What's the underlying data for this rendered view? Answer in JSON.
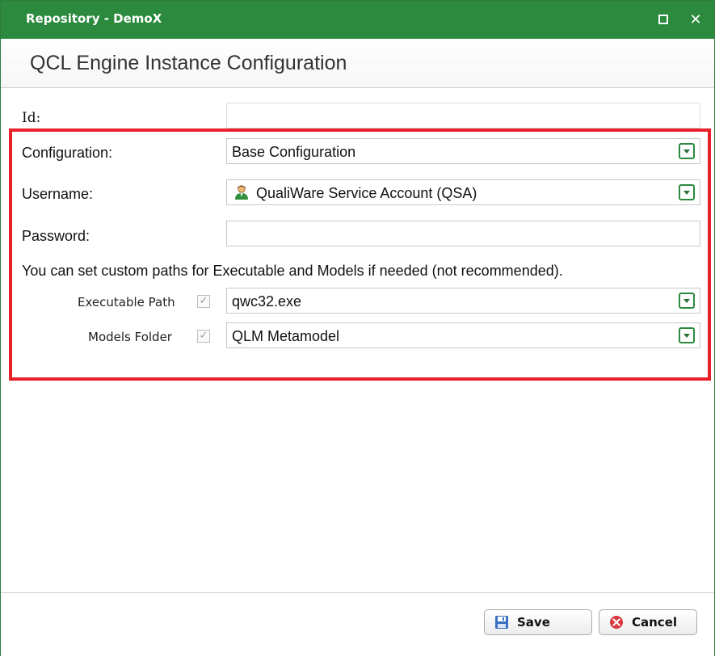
{
  "window": {
    "title": "Repository - DemoX",
    "accent_color": "#2b8a3e",
    "maximize_icon": "maximize-icon",
    "close_icon": "close-icon"
  },
  "header": {
    "heading": "QCL Engine Instance Configuration"
  },
  "form": {
    "id": {
      "label": "Id:",
      "value": ""
    },
    "configuration": {
      "label": "Configuration:",
      "value": "Base Configuration"
    },
    "username": {
      "label": "Username:",
      "value": "QualiWare Service Account (QSA)",
      "icon": "user-icon"
    },
    "password": {
      "label": "Password:",
      "value": ""
    },
    "custom_paths_note": "You can set custom paths for Executable and Models if needed (not recommended).",
    "executable_path": {
      "label": "Executable Path",
      "checked": true,
      "value": "qwc32.exe"
    },
    "models_folder": {
      "label": "Models Folder",
      "checked": true,
      "value": "QLM Metamodel"
    }
  },
  "highlight_color": "#e8202a",
  "footer": {
    "save_label": "Save",
    "save_icon": "floppy-disk-icon",
    "cancel_label": "Cancel",
    "cancel_icon": "cancel-icon"
  }
}
